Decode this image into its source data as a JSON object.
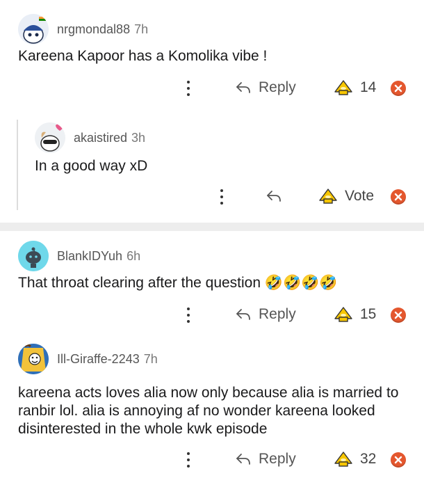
{
  "comments": [
    {
      "username": "nrgmondal88",
      "time": "7h",
      "body": "Kareena Kapoor has a Komolika vibe !",
      "reply_label": "Reply",
      "votes": "14"
    },
    {
      "username": "akaistired",
      "time": "3h",
      "body": "In a good way xD",
      "reply_label": "",
      "votes": "Vote"
    },
    {
      "username": "BlankIDYuh",
      "time": "6h",
      "body": "That throat clearing after the question 🤣🤣🤣🤣",
      "reply_label": "Reply",
      "votes": "15"
    },
    {
      "username": "Ill-Giraffe-2243",
      "time": "7h",
      "body": "kareena acts loves alia now only because alia is married to ranbir lol. alia is annoying af no wonder kareena looked disinterested in the whole kwk episode",
      "reply_label": "Reply",
      "votes": "32"
    }
  ],
  "icons": {
    "more": "more-options-icon",
    "reply": "reply-arrow-icon",
    "upvote": "upvote-icon",
    "downvote": "downvote-icon"
  },
  "colors": {
    "upvote": "#f7c600",
    "downvote": "#e4572e",
    "separator": "#ededed"
  }
}
